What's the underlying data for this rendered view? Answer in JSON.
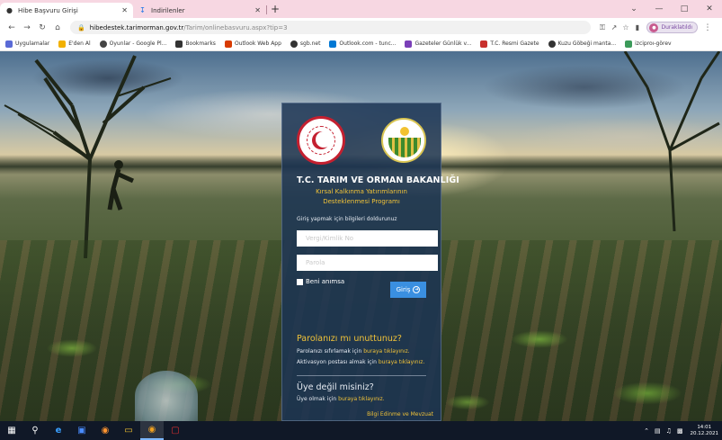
{
  "browser": {
    "tabs": [
      {
        "label": "Hibe Başvuru Girişi",
        "icon": "globe-icon",
        "active": true
      },
      {
        "label": "İndirilenler",
        "icon": "download-icon",
        "active": false
      }
    ],
    "address": {
      "host": "hibedestek.tarimorman.gov.tr",
      "path": "/Tarim/onlinebasvuru.aspx?tip=3"
    },
    "profile_label": "Duraklatıldı",
    "bookmarks": [
      {
        "label": "Uygulamalar",
        "color": "#5a6ad6"
      },
      {
        "label": "E'den Al",
        "color": "#f2b100"
      },
      {
        "label": "Oyunlar - Google Pl...",
        "color": "#444444"
      },
      {
        "label": "Bookmarks",
        "color": "#333333"
      },
      {
        "label": "Outlook Web App",
        "color": "#d83b01"
      },
      {
        "label": "sgb.net",
        "color": "#333333"
      },
      {
        "label": "Outlook.com - tunc...",
        "color": "#0078d4"
      },
      {
        "label": "Gazeteler Günlük v...",
        "color": "#7a3fb8"
      },
      {
        "label": "T.C. Resmi Gazete",
        "color": "#c8302d"
      },
      {
        "label": "Kuzu Göbeği manta...",
        "color": "#333333"
      },
      {
        "label": "izciproı-görev",
        "color": "#3b9a5a"
      }
    ]
  },
  "panel": {
    "ministry": "T.C. TARIM VE ORMAN BAKANLIĞI",
    "subtitle_line1": "Kırsal Kalkınma Yatırımlarının",
    "subtitle_line2": "Desteklenmesi Programı",
    "instruction": "Giriş yapmak için bilgileri doldurunuz",
    "tax_placeholder": "Vergi/Kimlik No",
    "password_placeholder": "Parola",
    "remember_label": "Beni anımsa",
    "login_label": "Giriş",
    "forgot_title": "Parolanızı mı unuttunuz?",
    "forgot_text": "Parolanızı sıfırlamak için",
    "forgot_link": "buraya tıklayınız.",
    "activation_text": "Aktivasyon postası almak için",
    "activation_link": "buraya tıklayınız.",
    "member_title": "Üye değil misiniz?",
    "member_text": "Üye olmak için",
    "member_link": "buraya tıklayınız.",
    "info_link": "Bilgi Edinme ve Mevzuat"
  },
  "taskbar": {
    "time": "14:01",
    "date": "20.12.2021"
  },
  "colors": {
    "panel_bg": "#1c3454",
    "accent_yellow": "#f0c238",
    "login_button": "#3a8fe0",
    "tab_strip": "#f7d7e2"
  }
}
